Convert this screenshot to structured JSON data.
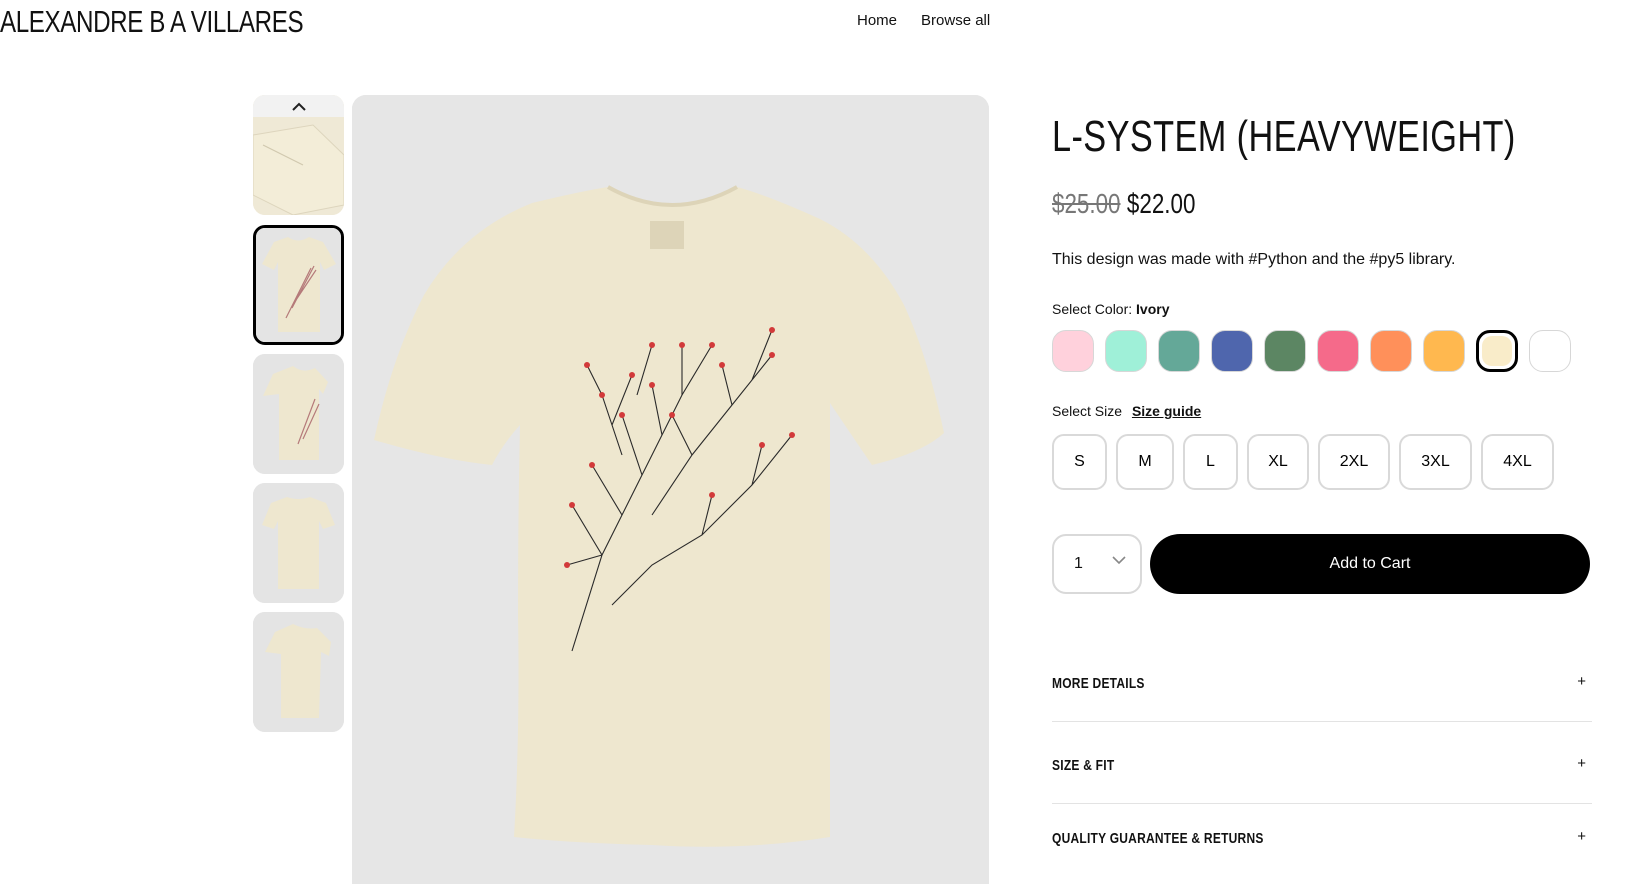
{
  "header": {
    "brand": "ALEXANDRE B A VILLARES",
    "nav": [
      "Home",
      "Browse all"
    ]
  },
  "product": {
    "title": "L-SYSTEM (HEAVYWEIGHT)",
    "price_old": "$25.00",
    "price_new": "$22.00",
    "description": "This design was made with #Python and the #py5 library."
  },
  "color": {
    "label": "Select Color:",
    "selected": "Ivory",
    "swatches": [
      "#ffd1dc",
      "#9ff0d8",
      "#64a898",
      "#4f66ad",
      "#5c8663",
      "#f56a8a",
      "#ff905a",
      "#ffb84f",
      "#f9ecc9",
      "#ffffff"
    ]
  },
  "size": {
    "label": "Select Size",
    "guide": "Size guide",
    "options": [
      "S",
      "M",
      "L",
      "XL",
      "2XL",
      "3XL",
      "4XL"
    ]
  },
  "cart": {
    "quantity": "1",
    "button": "Add to Cart"
  },
  "accordion": [
    "MORE DETAILS",
    "SIZE & FIT",
    "QUALITY GUARANTEE & RETURNS"
  ],
  "accordion_icon": "+",
  "colors": {
    "shirt": "#eee7cf",
    "background": "#e6e6e6",
    "accent": "#000000"
  }
}
